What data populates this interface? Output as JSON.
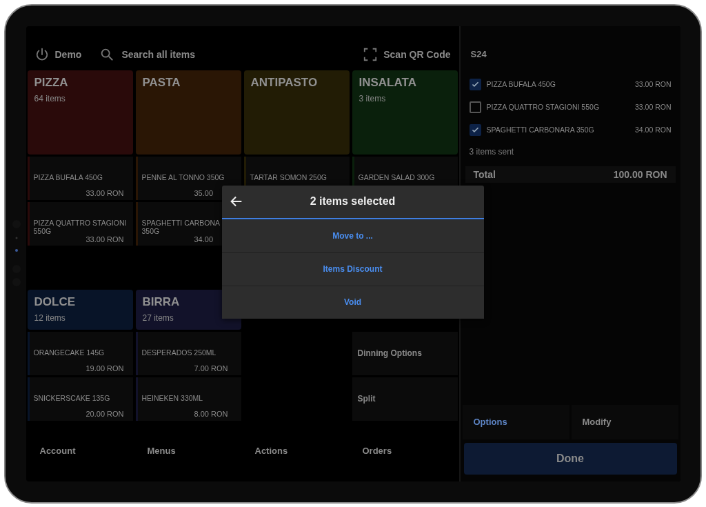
{
  "top_bar": {
    "user": "Demo",
    "search_placeholder": "Search all items",
    "scan": "Scan QR Code"
  },
  "upper_categories": [
    {
      "name": "PIZZA",
      "count": "64 items",
      "color": "#2a0a0a",
      "items": [
        {
          "name": "PIZZA BUFALA 450G",
          "price": "33.00 RON"
        },
        {
          "name": "PIZZA QUATTRO STAGIONI 550G",
          "price": "33.00 RON"
        }
      ]
    },
    {
      "name": "PASTA",
      "color": "#2a1605",
      "items": [
        {
          "name": "PENNE AL TONNO 350G",
          "price": "35.00"
        },
        {
          "name": "SPAGHETTI CARBONA 350G",
          "price": "34.00"
        }
      ]
    },
    {
      "name": "ANTIPASTO",
      "color": "#221c05",
      "items": [
        {
          "name": "TARTAR SOMON 250G"
        }
      ]
    },
    {
      "name": "INSALATA",
      "count": "3 items",
      "color": "#0a200c",
      "items": [
        {
          "name": "GARDEN SALAD 300G"
        }
      ]
    }
  ],
  "lower_categories": [
    {
      "name": "DOLCE",
      "count": "12 items",
      "color": "#081428",
      "items": [
        {
          "name": "ORANGECAKE 145G",
          "price": "19.00 RON"
        },
        {
          "name": "SNICKERSCAKE 135G",
          "price": "20.00 RON"
        }
      ]
    },
    {
      "name": "BIRRA",
      "count": "27 items",
      "color": "#12122a",
      "items": [
        {
          "name": "DESPERADOS 250ML",
          "price": "7.00 RON"
        },
        {
          "name": "HEINEKEN 330ML",
          "price": "8.00 RON"
        }
      ]
    }
  ],
  "side_actions": [
    "Dinning Options",
    "Split"
  ],
  "bottom_nav": [
    "Account",
    "Menus",
    "Actions",
    "Orders"
  ],
  "order": {
    "table": "S24",
    "lines": [
      {
        "name": "PIZZA BUFALA 450G",
        "price": "33.00 RON",
        "checked": true
      },
      {
        "name": "PIZZA QUATTRO STAGIONI 550G",
        "price": "33.00 RON",
        "checked": false
      },
      {
        "name": "SPAGHETTI CARBONARA 350G",
        "price": "34.00 RON",
        "checked": true
      }
    ],
    "sent": "3 items sent",
    "total_label": "Total",
    "total": "100.00 RON",
    "buttons": [
      "Options",
      "Modify"
    ],
    "done": "Done"
  },
  "dialog": {
    "title": "2 items selected",
    "options": [
      "Move to ...",
      "Items Discount",
      "Void"
    ]
  }
}
